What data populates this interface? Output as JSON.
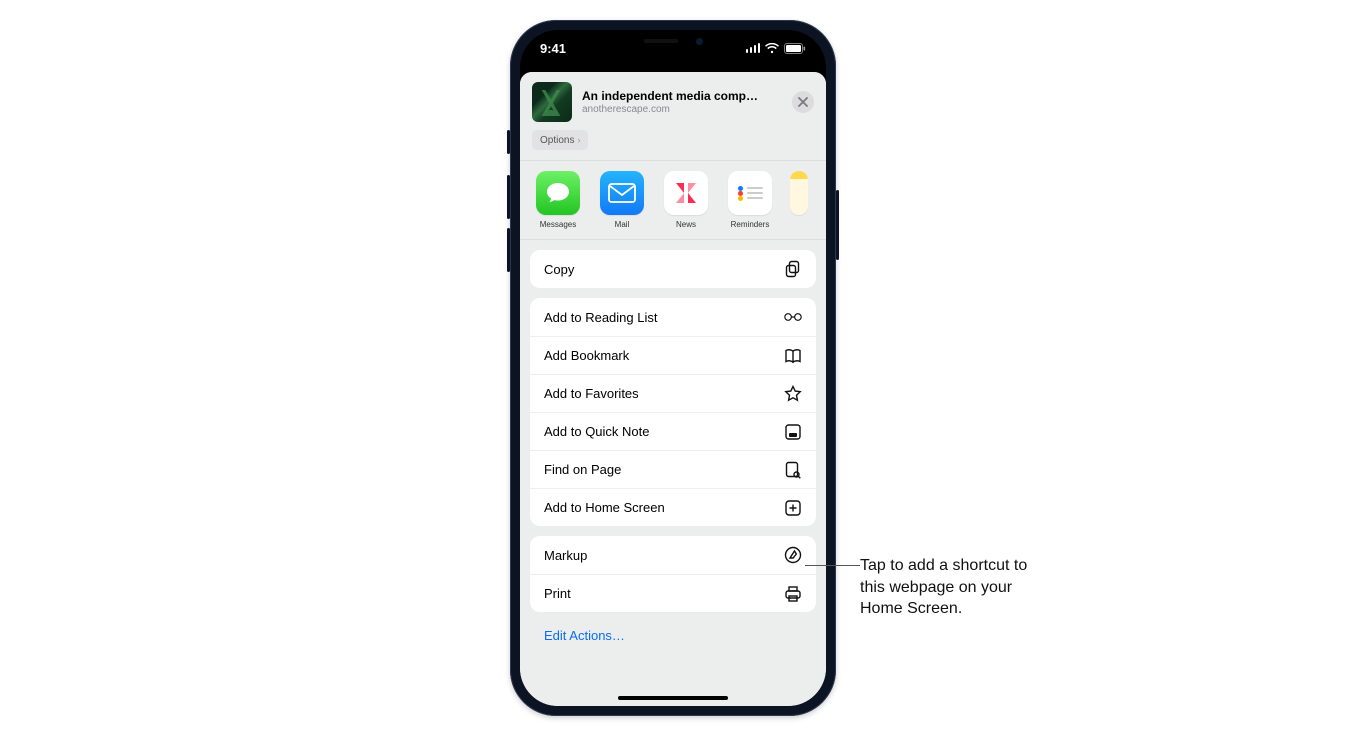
{
  "status": {
    "time": "9:41"
  },
  "share": {
    "title": "An independent media comp…",
    "domain": "anotherescape.com",
    "options_label": "Options"
  },
  "apps": {
    "messages": "Messages",
    "mail": "Mail",
    "news": "News",
    "reminders": "Reminders"
  },
  "actions": {
    "copy": "Copy",
    "reading_list": "Add to Reading List",
    "bookmark": "Add Bookmark",
    "favorites": "Add to Favorites",
    "quick_note": "Add to Quick Note",
    "find": "Find on Page",
    "home_screen": "Add to Home Screen",
    "markup": "Markup",
    "print": "Print",
    "edit": "Edit Actions…"
  },
  "callout": "Tap to add a shortcut to this webpage on your Home Screen."
}
